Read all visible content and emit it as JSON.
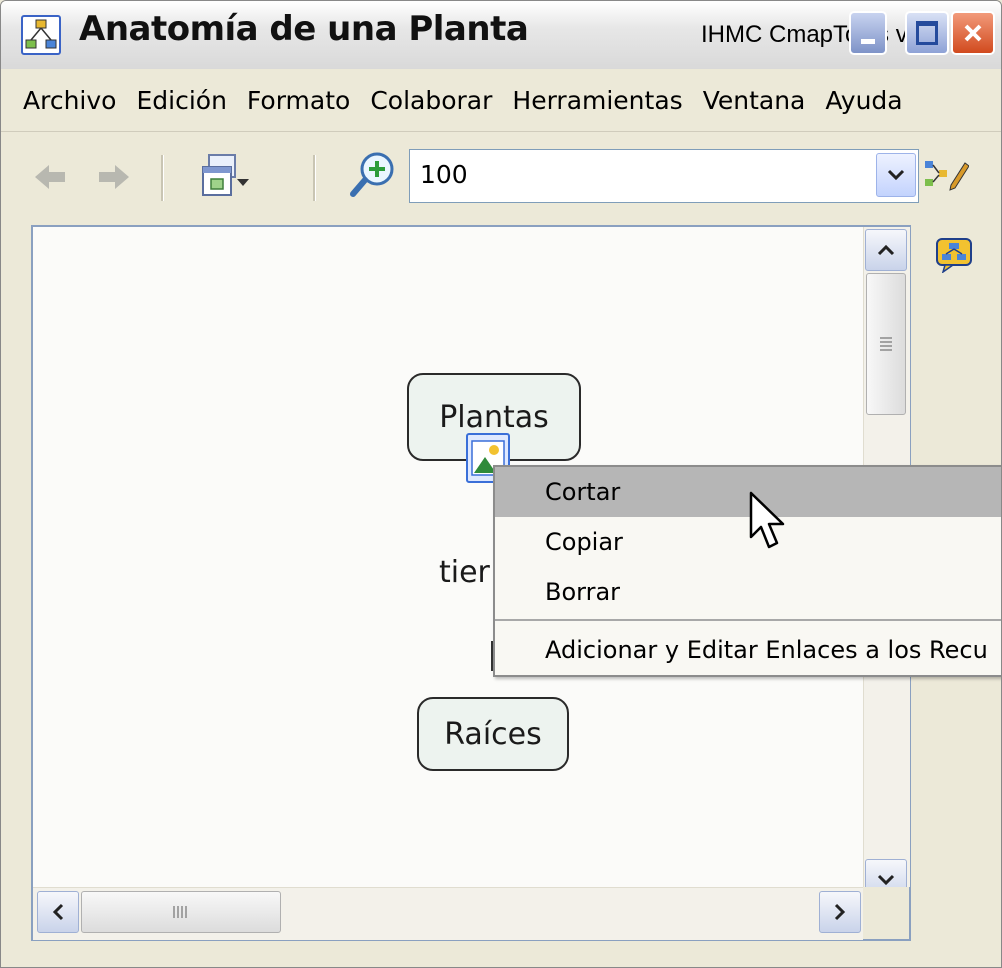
{
  "window": {
    "title": "Anatomía de una Planta",
    "subtitle": "IHMC CmapTools v4",
    "app_icon": "concept-map-icon"
  },
  "menubar": {
    "items": [
      "Archivo",
      "Edición",
      "Formato",
      "Colaborar",
      "Herramientas",
      "Ventana",
      "Ayuda"
    ]
  },
  "toolbar": {
    "back_icon": "back-arrow-icon",
    "forward_icon": "forward-arrow-icon",
    "view_icon": "view-mode-icon",
    "zoom_icon": "zoom-in-icon",
    "zoom_value": "100"
  },
  "map": {
    "nodes": [
      {
        "label": "Plantas"
      },
      {
        "label": "Raíces"
      }
    ],
    "link_label": "tier"
  },
  "context_menu": {
    "items": [
      {
        "label": "Cortar",
        "selected": true
      },
      {
        "label": "Copiar",
        "selected": false
      },
      {
        "label": "Borrar",
        "selected": false
      },
      {
        "label": "Adicionar y Editar Enlaces a los Recu",
        "selected": false
      }
    ]
  },
  "colors": {
    "titlebar": "#e7e7e7",
    "chrome": "#ece9d8",
    "canvas_bg": "#fbfbf9",
    "node_fill": "#edf3ef",
    "menu_highlight": "#b6b6b6",
    "close_button": "#d14a1e"
  }
}
